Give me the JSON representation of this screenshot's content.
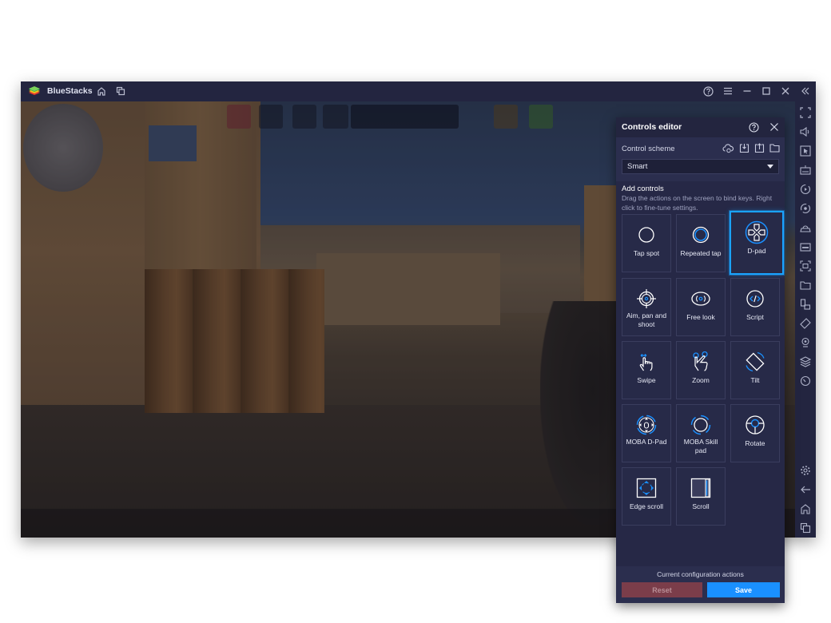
{
  "window": {
    "app_title": "BlueStacks",
    "titlebar_icons": [
      "home-icon",
      "multi-instance-icon"
    ],
    "window_controls": [
      "help-icon",
      "menu-icon",
      "minimize-icon",
      "maximize-icon",
      "close-icon",
      "collapse-sidebar-icon"
    ]
  },
  "sidebar": {
    "top_items": [
      {
        "name": "fullscreen-icon"
      },
      {
        "name": "volume-icon"
      },
      {
        "name": "cursor-icon"
      },
      {
        "name": "keyboard-icon"
      },
      {
        "name": "record-icon"
      },
      {
        "name": "sync-icon"
      },
      {
        "name": "install-apk-icon"
      },
      {
        "name": "apk-icon"
      },
      {
        "name": "screenshot-icon"
      },
      {
        "name": "folder-icon"
      },
      {
        "name": "multi-instance-icon"
      },
      {
        "name": "rotate-icon"
      },
      {
        "name": "location-icon"
      },
      {
        "name": "layers-icon"
      },
      {
        "name": "performance-icon"
      }
    ],
    "bottom_items": [
      {
        "name": "settings-icon"
      },
      {
        "name": "back-icon"
      },
      {
        "name": "home-icon"
      },
      {
        "name": "recent-apps-icon"
      }
    ]
  },
  "controls_editor": {
    "title": "Controls editor",
    "scheme_label": "Control scheme",
    "scheme_icons": [
      "cloud-sync-icon",
      "import-icon",
      "export-icon",
      "folder-icon"
    ],
    "scheme_value": "Smart",
    "add_controls_title": "Add controls",
    "add_controls_desc": "Drag the actions on the screen to bind keys. Right click to fine-tune settings.",
    "controls": [
      {
        "label": "Tap spot",
        "icon": "tap-spot-icon",
        "selected": false
      },
      {
        "label": "Repeated tap",
        "icon": "repeated-tap-icon",
        "selected": false
      },
      {
        "label": "D-pad",
        "icon": "dpad-icon",
        "selected": true
      },
      {
        "label": "Aim, pan and shoot",
        "icon": "crosshair-icon",
        "selected": false
      },
      {
        "label": "Free look",
        "icon": "eye-icon",
        "selected": false
      },
      {
        "label": "Script",
        "icon": "script-icon",
        "selected": false
      },
      {
        "label": "Swipe",
        "icon": "swipe-icon",
        "selected": false
      },
      {
        "label": "Zoom",
        "icon": "zoom-gesture-icon",
        "selected": false
      },
      {
        "label": "Tilt",
        "icon": "tilt-icon",
        "selected": false
      },
      {
        "label": "MOBA D-Pad",
        "icon": "moba-dpad-icon",
        "selected": false
      },
      {
        "label": "MOBA Skill pad",
        "icon": "moba-skill-icon",
        "selected": false
      },
      {
        "label": "Rotate",
        "icon": "rotate-control-icon",
        "selected": false
      },
      {
        "label": "Edge scroll",
        "icon": "edge-scroll-icon",
        "selected": false
      },
      {
        "label": "Scroll",
        "icon": "scroll-icon",
        "selected": false
      }
    ],
    "footer_title": "Current configuration actions",
    "reset_label": "Reset",
    "save_label": "Save"
  },
  "colors": {
    "accent": "#1a90ff",
    "selected_border": "#1aa3ff",
    "reset_bg": "#7b3d4a",
    "panel_bg": "#262846"
  }
}
